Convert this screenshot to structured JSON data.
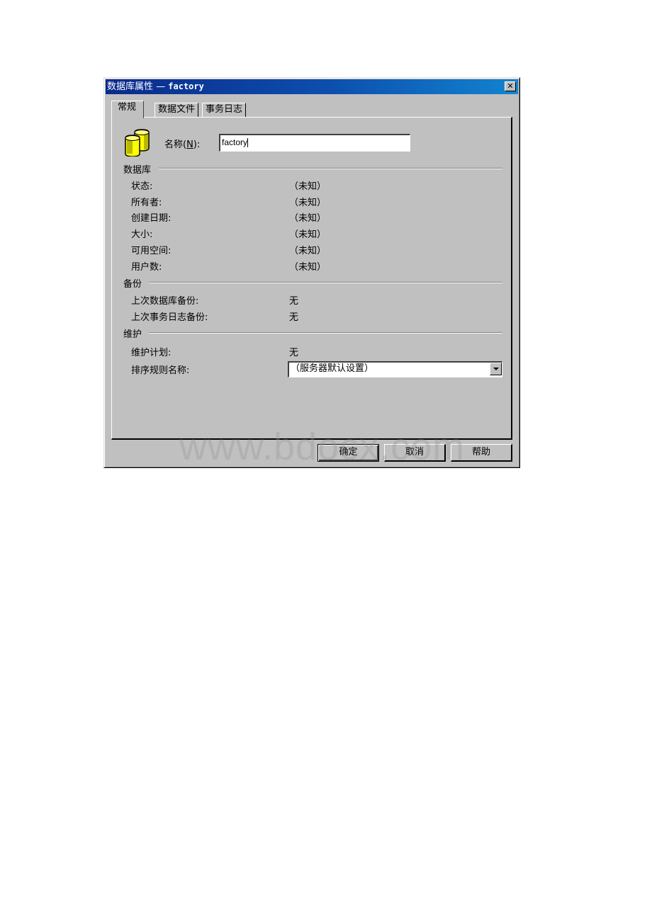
{
  "window": {
    "title_prefix": "数据库属性 — ",
    "title_name": "factory",
    "close_glyph": "✕"
  },
  "tabs": [
    {
      "label": "常规",
      "active": true
    },
    {
      "label": "数据文件",
      "active": false
    },
    {
      "label": "事务日志",
      "active": false
    }
  ],
  "general": {
    "icon": "database-icon",
    "name_label": "名称(",
    "name_mnemonic": "N",
    "name_label_end": "):",
    "name_value": "factory"
  },
  "database_section": {
    "title": "数据库",
    "rows": [
      {
        "label": "状态:",
        "value": "（未知）"
      },
      {
        "label": "所有者:",
        "value": "（未知）"
      },
      {
        "label": "创建日期:",
        "value": "（未知）"
      },
      {
        "label": "大小:",
        "value": "（未知）"
      },
      {
        "label": "可用空间:",
        "value": "（未知）"
      },
      {
        "label": "用户数:",
        "value": "（未知）"
      }
    ]
  },
  "backup_section": {
    "title": "备份",
    "rows": [
      {
        "label": "上次数据库备份:",
        "value": "无"
      },
      {
        "label": "上次事务日志备份:",
        "value": "无"
      }
    ]
  },
  "maintenance_section": {
    "title": "维护",
    "plan_label": "维护计划:",
    "plan_value": "无",
    "collation_label": "排序规则名称:",
    "collation_selected": "（服务器默认设置）"
  },
  "buttons": {
    "ok": "确定",
    "cancel": "取消",
    "help": "帮助"
  },
  "watermark": "www.bdocx.com"
}
